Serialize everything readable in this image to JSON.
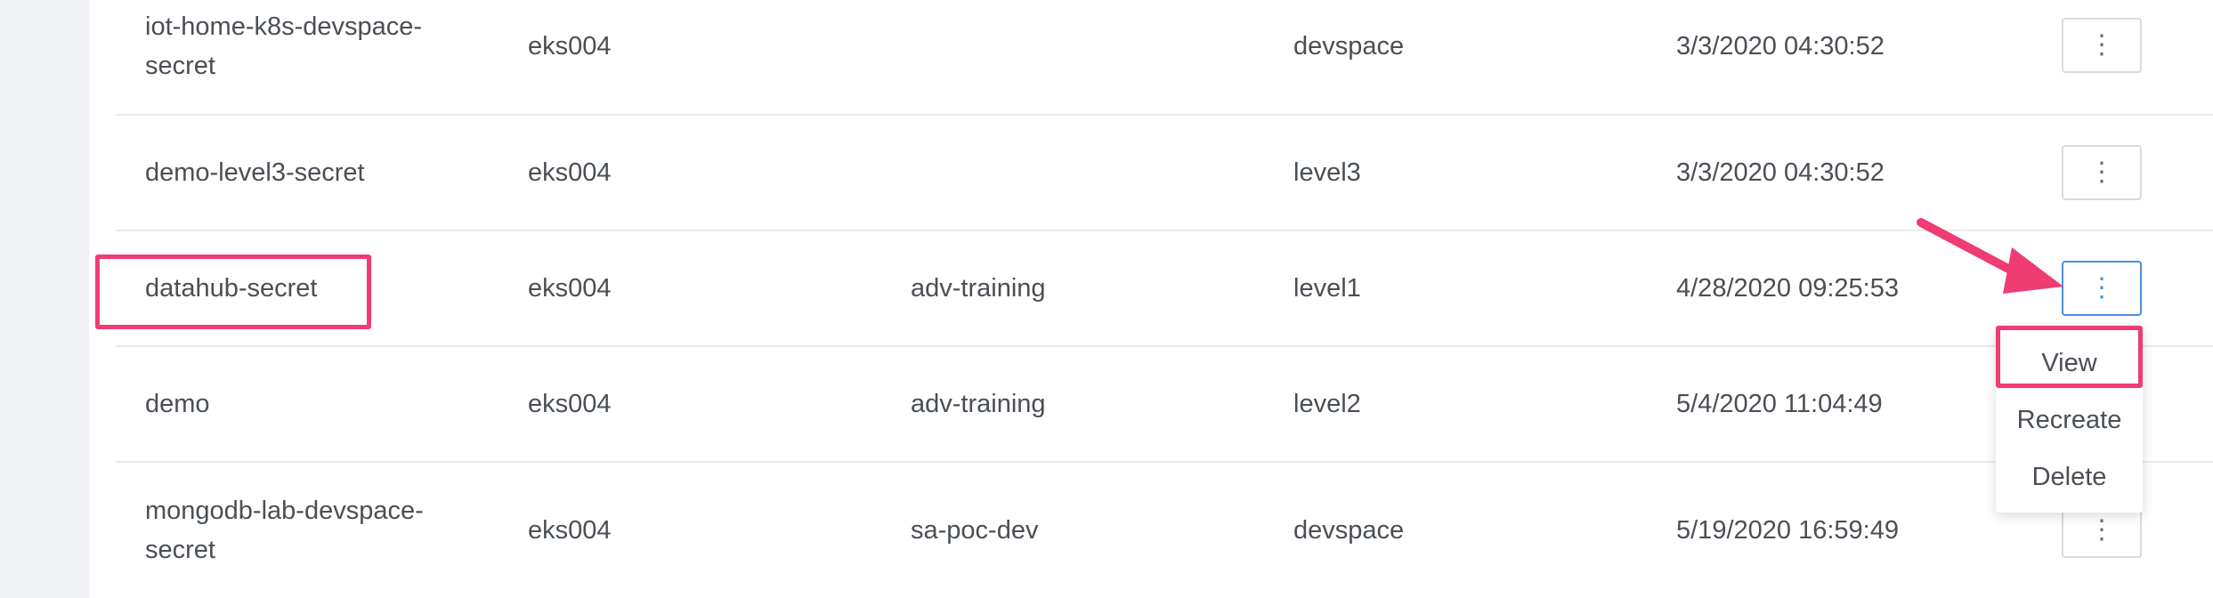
{
  "rows": [
    {
      "name_line1": "iot-home-k8s-devspace-",
      "name_line2": "secret",
      "cluster": "eks004",
      "namespace": "",
      "space": "devspace",
      "created": "3/3/2020 04:30:52"
    },
    {
      "name_line1": "demo-level3-secret",
      "name_line2": "",
      "cluster": "eks004",
      "namespace": "",
      "space": "level3",
      "created": "3/3/2020 04:30:52"
    },
    {
      "name_line1": "datahub-secret",
      "name_line2": "",
      "cluster": "eks004",
      "namespace": "adv-training",
      "space": "level1",
      "created": "4/28/2020 09:25:53"
    },
    {
      "name_line1": "demo",
      "name_line2": "",
      "cluster": "eks004",
      "namespace": "adv-training",
      "space": "level2",
      "created": "5/4/2020 11:04:49"
    },
    {
      "name_line1": "mongodb-lab-devspace-",
      "name_line2": "secret",
      "cluster": "eks004",
      "namespace": "sa-poc-dev",
      "space": "devspace",
      "created": "5/19/2020 16:59:49"
    }
  ],
  "actions": {
    "kebab_glyph": "⋮",
    "menu": {
      "view": "View",
      "recreate": "Recreate",
      "delete": "Delete"
    }
  },
  "colors": {
    "highlight": "#ef3c72",
    "active_border": "#4a90d9",
    "rail": "#f0f1f5"
  }
}
